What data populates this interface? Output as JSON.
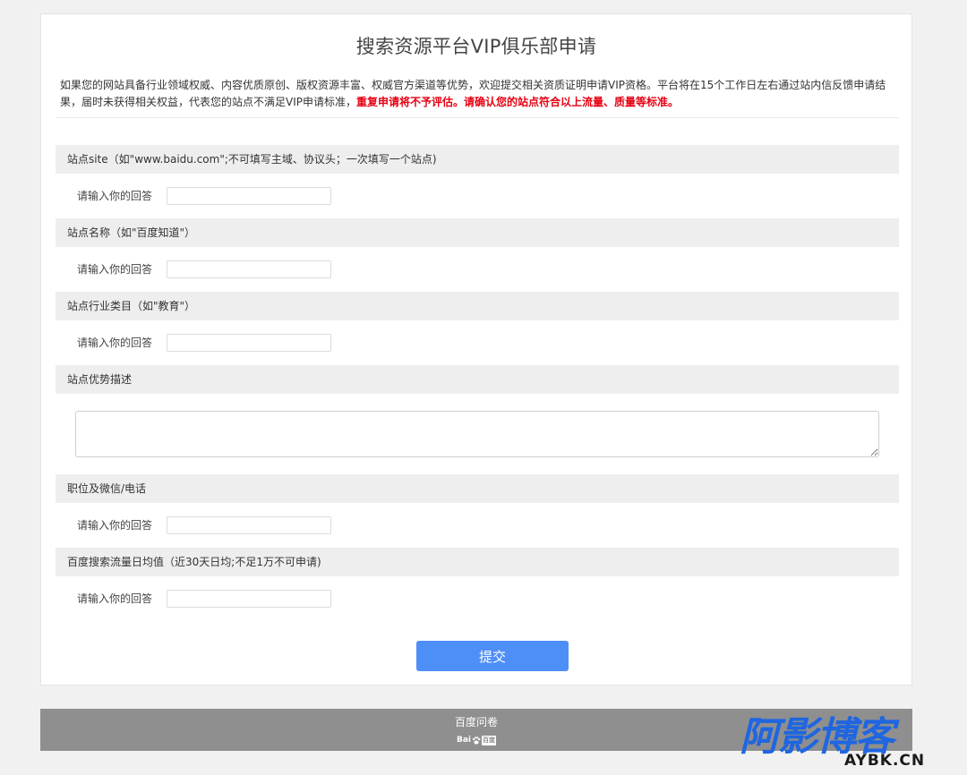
{
  "form": {
    "title": "搜索资源平台VIP俱乐部申请",
    "intro_text": "如果您的网站具备行业领域权威、内容优质原创、版权资源丰富、权威官方渠道等优势，欢迎提交相关资质证明申请VIP资格。平台将在15个工作日左右通过站内信反馈申请结果，届时未获得相关权益，代表您的站点不满足VIP申请标准，",
    "intro_warning": "重复申请将不予评估。请确认您的站点符合以上流量、质量等标准。",
    "answer_label": "请输入你的回答",
    "questions": [
      {
        "title": "站点site（如\"www.baidu.com\";不可填写主域、协议头；一次填写一个站点)",
        "value": ""
      },
      {
        "title": "站点名称（如\"百度知道\"）",
        "value": ""
      },
      {
        "title": "站点行业类目（如\"教育\"）",
        "value": ""
      },
      {
        "title": "站点优势描述",
        "value": ""
      },
      {
        "title": "职位及微信/电话",
        "value": ""
      },
      {
        "title": "百度搜索流量日均值（近30天日均;不足1万不可申请)",
        "value": ""
      }
    ],
    "submit_label": "提交"
  },
  "footer": {
    "text": "百度问卷",
    "logo_text": "Bai",
    "logo_badge": "百度"
  },
  "watermark": {
    "main": "阿影博客",
    "sub": "AYBK.CN"
  },
  "colors": {
    "accent": "#4e8ef7",
    "warning": "#e60012",
    "footer_bg": "#8f8f8f",
    "watermark_blue": "#1f66e0"
  }
}
